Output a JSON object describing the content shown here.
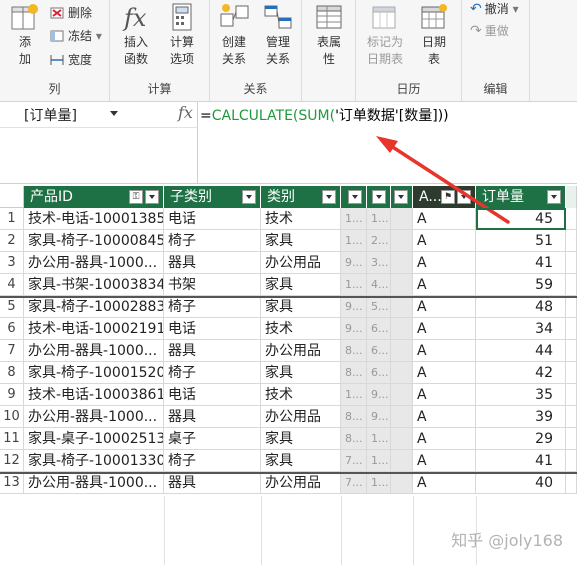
{
  "ribbon": {
    "groups": [
      {
        "label": "列"
      },
      {
        "label": "计算"
      },
      {
        "label": "关系"
      },
      {
        "label": "日历"
      },
      {
        "label": "编辑"
      }
    ],
    "add_label": "添\n加",
    "delete_label": "删除",
    "freeze_label": "冻结",
    "width_label": "宽度",
    "insert_function_label": "插入\n函数",
    "calc_options_label": "计算\n选项",
    "create_relationship_label": "创建\n关系",
    "manage_relationship_label": "管理\n关系",
    "table_props_label": "表属\n性",
    "mark_date_table_label": "标记为\n日期表",
    "date_table_label": "日期\n表",
    "undo_label": "撤消",
    "redo_label": "重做"
  },
  "formula_bar": {
    "name_box": "[订单量]",
    "fx": "fx",
    "formula_prefix": "=",
    "formula_fn1": "CALCULATE(",
    "formula_fn2": "SUM(",
    "formula_ref": "'订单数据'[数量]",
    "formula_suffix": "))"
  },
  "table": {
    "headers": [
      "产品ID",
      "子类别",
      "类别",
      "",
      "",
      "",
      "A...",
      "订单量"
    ],
    "rows": [
      {
        "n": "1",
        "id": "技术-电话-10001385",
        "sub": "电话",
        "cat": "技术",
        "g1": "1...",
        "g2": "1...",
        "a": "A",
        "qty": "45"
      },
      {
        "n": "2",
        "id": "家具-椅子-10000845",
        "sub": "椅子",
        "cat": "家具",
        "g1": "1...",
        "g2": "2...",
        "a": "A",
        "qty": "51"
      },
      {
        "n": "3",
        "id": "办公用-器具-1000...",
        "sub": "器具",
        "cat": "办公用品",
        "g1": "9...",
        "g2": "3...",
        "a": "A",
        "qty": "41"
      },
      {
        "n": "4",
        "id": "家具-书架-10003834",
        "sub": "书架",
        "cat": "家具",
        "g1": "1...",
        "g2": "4...",
        "a": "A",
        "qty": "59"
      },
      {
        "n": "5",
        "id": "家具-椅子-10002883",
        "sub": "椅子",
        "cat": "家具",
        "g1": "9...",
        "g2": "5...",
        "a": "A",
        "qty": "48"
      },
      {
        "n": "6",
        "id": "技术-电话-10002191",
        "sub": "电话",
        "cat": "技术",
        "g1": "9...",
        "g2": "6...",
        "a": "A",
        "qty": "34"
      },
      {
        "n": "7",
        "id": "办公用-器具-1000...",
        "sub": "器具",
        "cat": "办公用品",
        "g1": "8...",
        "g2": "6...",
        "a": "A",
        "qty": "44"
      },
      {
        "n": "8",
        "id": "家具-椅子-10001520",
        "sub": "椅子",
        "cat": "家具",
        "g1": "8...",
        "g2": "6...",
        "a": "A",
        "qty": "42"
      },
      {
        "n": "9",
        "id": "技术-电话-10003861",
        "sub": "电话",
        "cat": "技术",
        "g1": "1...",
        "g2": "9...",
        "a": "A",
        "qty": "35"
      },
      {
        "n": "10",
        "id": "办公用-器具-1000...",
        "sub": "器具",
        "cat": "办公用品",
        "g1": "8...",
        "g2": "9...",
        "a": "A",
        "qty": "39"
      },
      {
        "n": "11",
        "id": "家具-桌子-10002513",
        "sub": "桌子",
        "cat": "家具",
        "g1": "8...",
        "g2": "1...",
        "a": "A",
        "qty": "29"
      },
      {
        "n": "12",
        "id": "家具-椅子-10001330",
        "sub": "椅子",
        "cat": "家具",
        "g1": "7...",
        "g2": "1...",
        "a": "A",
        "qty": "41"
      },
      {
        "n": "13",
        "id": "办公用-器具-1000...",
        "sub": "器具",
        "cat": "办公用品",
        "g1": "7...",
        "g2": "1...",
        "a": "A",
        "qty": "40"
      }
    ]
  },
  "watermark": "知乎 @joly168",
  "colors": {
    "header_green": "#1e7145",
    "header_dark": "#2d3b2f",
    "formula_green": "#1e9a3c",
    "arrow_red": "#e8352c"
  }
}
